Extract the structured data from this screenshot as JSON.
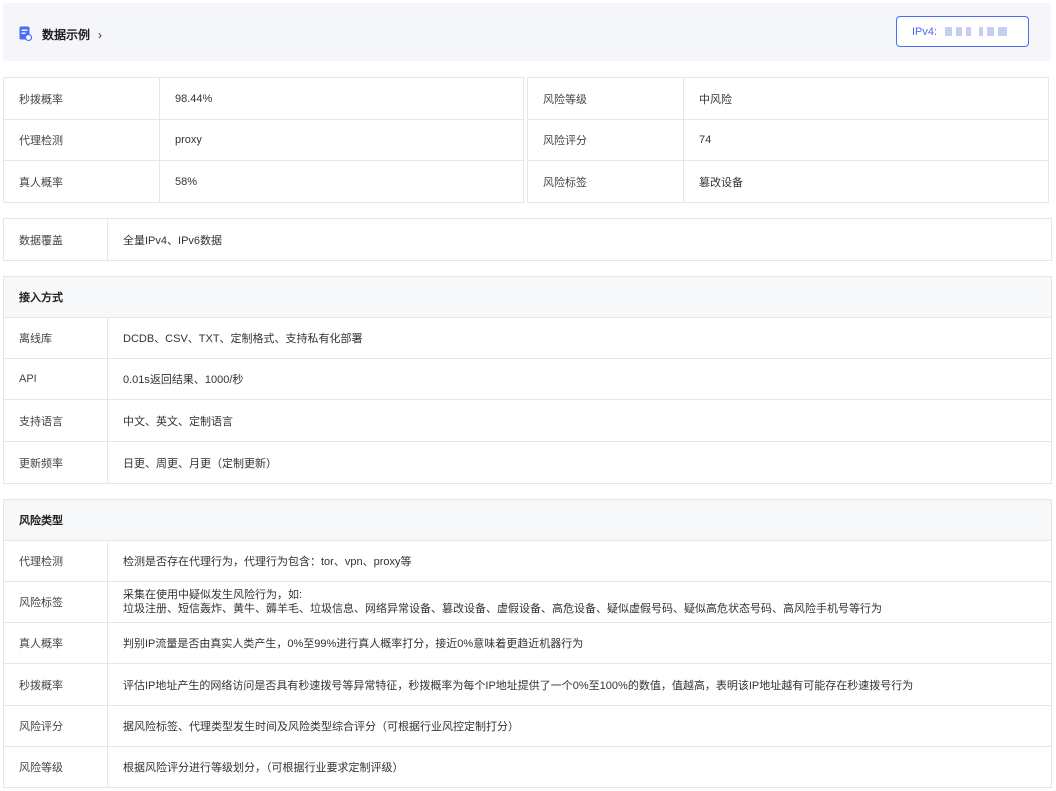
{
  "header": {
    "title": "数据示例",
    "chevron": "›",
    "ip_label": "IPv4:"
  },
  "summary_left": [
    {
      "key": "秒拨概率",
      "value": "98.44%"
    },
    {
      "key": "代理检测",
      "value": "proxy"
    },
    {
      "key": "真人概率",
      "value": "58%"
    }
  ],
  "summary_right": [
    {
      "key": "风险等级",
      "value": "中风险"
    },
    {
      "key": "风险评分",
      "value": "74"
    },
    {
      "key": "风险标签",
      "value": "篡改设备"
    }
  ],
  "coverage": {
    "key": "数据覆盖",
    "value": "全量IPv4、IPv6数据"
  },
  "access": {
    "title": "接入方式",
    "rows": [
      {
        "key": "离线库",
        "value": "DCDB、CSV、TXT、定制格式、支持私有化部署"
      },
      {
        "key": "API",
        "value": "0.01s返回结果、1000/秒"
      },
      {
        "key": "支持语言",
        "value": "中文、英文、定制语言"
      },
      {
        "key": "更新频率",
        "value": "日更、周更、月更（定制更新）"
      }
    ]
  },
  "risk_types": {
    "title": "风险类型",
    "rows": [
      {
        "key": "代理检测",
        "value": "检测是否存在代理行为，代理行为包含：tor、vpn、proxy等"
      },
      {
        "key": "风险标签",
        "value": "采集在使用中疑似发生风险行为，如:",
        "value2": "垃圾注册、短信轰炸、黄牛、薅羊毛、垃圾信息、网络异常设备、篡改设备、虚假设备、高危设备、疑似虚假号码、疑似高危状态号码、高风险手机号等行为"
      },
      {
        "key": "真人概率",
        "value": "判别IP流量是否由真实人类产生，0%至99%进行真人概率打分，接近0%意味着更趋近机器行为"
      },
      {
        "key": "秒拨概率",
        "value": "评估IP地址产生的网络访问是否具有秒速拨号等异常特征，秒拨概率为每个IP地址提供了一个0%至100%的数值，值越高，表明该IP地址越有可能存在秒速拨号行为"
      },
      {
        "key": "风险评分",
        "value": "据风险标签、代理类型发生时间及风险类型综合评分（可根据行业风控定制打分）"
      },
      {
        "key": "风险等级",
        "value": "根据风险评分进行等级划分，（可根据行业要求定制评级）"
      }
    ]
  },
  "colors": {
    "accent": "#4a6cf7",
    "border": "#e6e6e6",
    "header_bg": "#f5f6fa"
  }
}
